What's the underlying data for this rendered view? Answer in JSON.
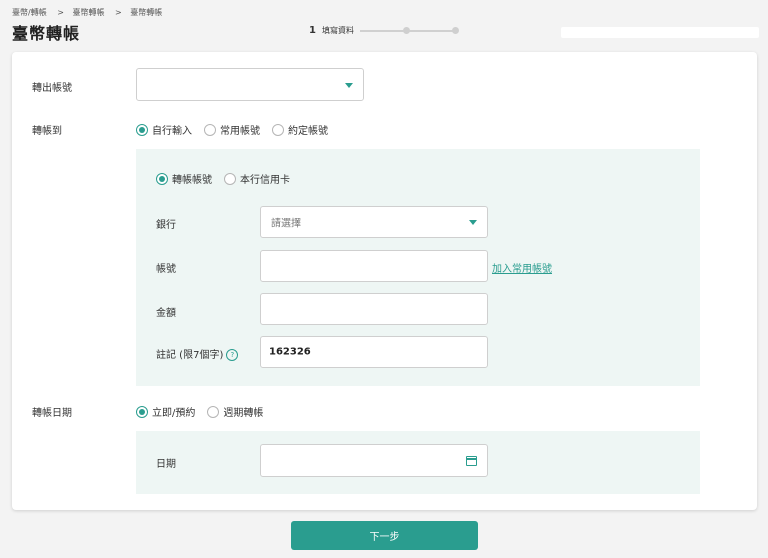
{
  "breadcrumb": [
    "臺幣/轉帳",
    "臺幣轉帳",
    "臺幣轉帳"
  ],
  "breadcrumb_sep": ">",
  "page_title": "臺幣轉帳",
  "steps": {
    "current_num": "1",
    "current_label": "填寫資料"
  },
  "form": {
    "from_account_label": "轉出帳號",
    "transfer_to_label": "轉帳到",
    "transfer_to_options": [
      "自行輸入",
      "常用帳號",
      "約定帳號"
    ],
    "transfer_to_selected": 0,
    "account_type_options": [
      "轉帳帳號",
      "本行信用卡"
    ],
    "account_type_selected": 0,
    "bank_label": "銀行",
    "bank_placeholder": "請選擇",
    "account_label": "帳號",
    "add_common_link": "加入常用帳號",
    "amount_label": "金額",
    "memo_label": "註記 (限7個字)",
    "memo_help": "?",
    "memo_value": "162326",
    "transfer_date_label": "轉帳日期",
    "date_options": [
      "立即/預約",
      "週期轉帳"
    ],
    "date_selected": 0,
    "date_label": "日期"
  },
  "next_button": "下一步",
  "colors": {
    "accent": "#2a9d8f",
    "panel_bg": "#eef6f4"
  }
}
